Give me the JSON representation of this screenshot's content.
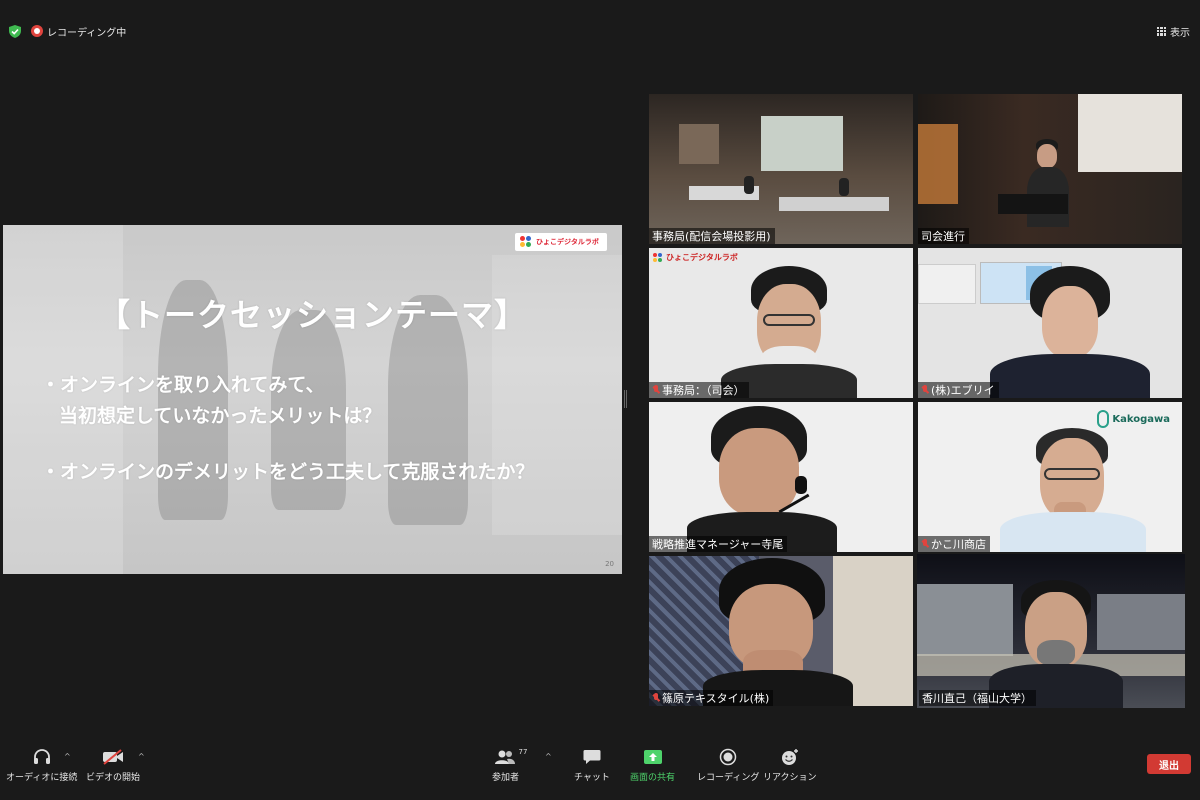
{
  "topbar": {
    "recording_label": "レコーディング中",
    "view_label": "表示",
    "icons": [
      "shield-check-icon",
      "recording-icon",
      "grid-view-icon"
    ]
  },
  "slide": {
    "logo_text": "ひょこデジタルラボ",
    "title": "【トークセッションテーマ】",
    "bullet_1_line_1": "・オンラインを取り入れてみて、",
    "bullet_1_line_2": "当初想定していなかったメリットは？",
    "bullet_2": "・オンラインのデメリットをどう工夫して克服されたか？",
    "page_number": "20"
  },
  "participants": [
    {
      "name": "事務局(配信会場投影用)",
      "muted": false
    },
    {
      "name": "司会進行",
      "muted": false
    },
    {
      "name": "事務局：（司会）",
      "muted": true,
      "logo_text": "ひょこデジタルラボ"
    },
    {
      "name": "(株)エブリイ",
      "muted": true
    },
    {
      "name": "戦略推進マネージャー寺尾",
      "muted": false
    },
    {
      "name": "かこ川商店",
      "muted": true,
      "logo_text": "Kakogawa"
    },
    {
      "name": "篠原テキスタイル(株)",
      "muted": true
    },
    {
      "name": "香川直己（福山大学）",
      "muted": false,
      "active_speaker": true
    }
  ],
  "toolbar": {
    "audio_label": "オーディオに接続",
    "video_label": "ビデオの開始",
    "participants_label": "参加者",
    "participants_count": "77",
    "chat_label": "チャット",
    "share_label": "画面の共有",
    "record_label": "レコーディング",
    "reaction_label": "リアクション",
    "leave_label": "退出",
    "accent_green": "#4ed36b",
    "leave_color": "#d23a33"
  }
}
